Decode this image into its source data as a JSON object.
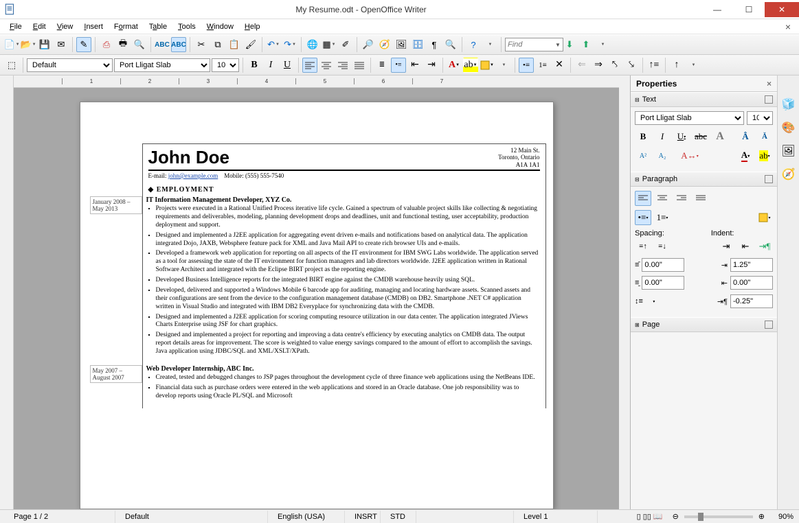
{
  "window": {
    "title": "My Resume.odt - OpenOffice Writer"
  },
  "menubar": {
    "file": "File",
    "edit": "Edit",
    "view": "View",
    "insert": "Insert",
    "format": "Format",
    "table": "Table",
    "tools": "Tools",
    "window": "Window",
    "help": "Help"
  },
  "toolbar1": {
    "find_placeholder": "Find"
  },
  "formatbar": {
    "style": "Default",
    "font": "Port Lligat Slab",
    "size": "10"
  },
  "sidebar": {
    "title": "Properties",
    "text": {
      "header": "Text",
      "font": "Port Lligat Slab",
      "size": "10"
    },
    "paragraph": {
      "header": "Paragraph",
      "spacing_label": "Spacing:",
      "indent_label": "Indent:",
      "above": "0.00\"",
      "below": "0.00\"",
      "left": "1.25\"",
      "right": "0.00\"",
      "firstline": "-0.25\""
    },
    "page": {
      "header": "Page"
    }
  },
  "document": {
    "name": "John Doe",
    "addr1": "12 Main St.",
    "addr2": "Toronto, Ontario",
    "addr3": "A1A 1A1",
    "email_label": "E-mail:",
    "email": "john@example.com",
    "mobile_label": "Mobile:",
    "mobile": "(555) 555-7540",
    "section_employment": "EMPLOYMENT",
    "job1": {
      "dates": "January 2008 – May 2013",
      "title": "IT Information Management Developer, XYZ Co.",
      "items": [
        "Projects were executed in a Rational Unified Process iterative life cycle. Gained a spectrum of valuable project skills like collecting & negotiating requirements and deliverables, modeling, planning development drops and deadlines, unit and functional testing, user acceptability, production deployment and support.",
        "Designed and implemented a J2EE application for aggregating event driven e-mails and notifications based on analytical data. The application integrated Dojo, JAXB, Websphere feature pack for XML and Java Mail API to create rich browser UIs and e-mails.",
        "Developed a framework web application for reporting on all aspects of the IT environment for IBM SWG Labs worldwide. The application served as a tool for assessing the state of the IT environment for function managers and lab directors worldwide. J2EE application written in Rational Software Architect and integrated with the Eclipse BIRT project as the reporting engine.",
        "Developed Business Intelligence reports for the integrated BIRT engine against the CMDB warehouse heavily using SQL.",
        "Developed, delivered and supported a Windows Mobile 6 barcode app for auditing, managing and locating hardware assets. Scanned assets and their configurations are sent from the device to the configuration management database (CMDB) on DB2. Smartphone .NET C# application written in Visual Studio and integrated with IBM DB2 Everyplace for synchronizing data with the CMDB.",
        "Designed and implemented a J2EE application for scoring computing resource utilization in our data center. The application integrated JViews Charts Enterprise using JSF for chart graphics.",
        "Designed and implemented a project for reporting and improving a data centre's efficiency by executing analytics on CMDB data. The output report details areas for improvement. The score is weighted to value energy savings compared to the amount of effort to accomplish the savings. Java application using JDBC/SQL and XML/XSLT/XPath."
      ]
    },
    "job2": {
      "dates": "May 2007 – August 2007",
      "title": "Web Developer Internship, ABC Inc.",
      "items": [
        "Created, tested and debugged changes to JSP pages throughout the development cycle of three finance web applications using the NetBeans IDE.",
        "Financial data such as purchase orders were entered in the web applications and stored in an Oracle database. One job responsibility was to develop reports using Oracle PL/SQL and Microsoft"
      ]
    }
  },
  "statusbar": {
    "page": "Page 1 / 2",
    "style": "Default",
    "lang": "English (USA)",
    "ins": "INSRT",
    "std": "STD",
    "level": "Level 1",
    "zoom": "90%"
  }
}
